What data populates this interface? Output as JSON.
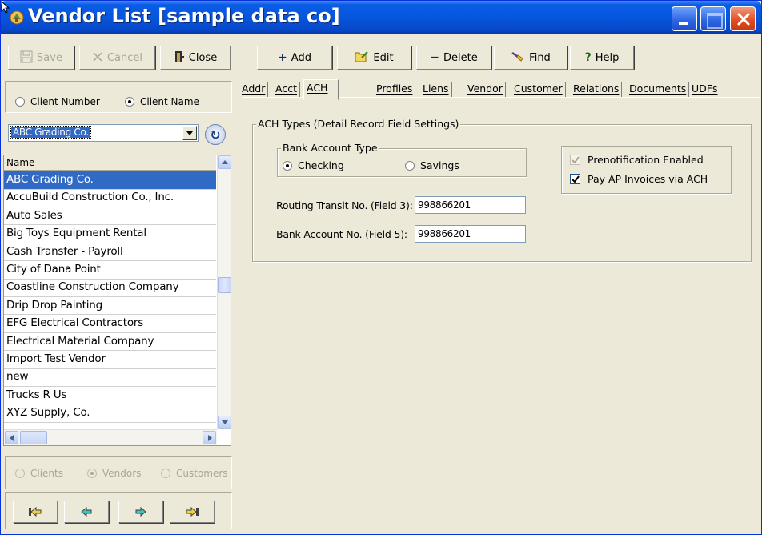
{
  "window": {
    "title": "Vendor List [sample data co]"
  },
  "toolbar": {
    "save": "Save",
    "cancel": "Cancel",
    "close": "Close",
    "add": "Add",
    "edit": "Edit",
    "delete": "Delete",
    "find": "Find",
    "help": "Help"
  },
  "sort": {
    "client_number": "Client Number",
    "client_name": "Client Name",
    "selected": "client_name"
  },
  "combo": {
    "value": "ABC Grading Co."
  },
  "list": {
    "header": "Name",
    "rows": [
      "ABC Grading Co.",
      "AccuBuild Construction Co., Inc.",
      "Auto Sales",
      "Big Toys Equipment Rental",
      "Cash Transfer - Payroll",
      "City of Dana Point",
      "Coastline Construction Company",
      "Drip Drop Painting",
      "EFG Electrical Contractors",
      "Electrical Material Company",
      "Import Test Vendor",
      "new",
      "Trucks R Us",
      "XYZ Supply, Co."
    ],
    "selected_index": 0
  },
  "entity_type": {
    "clients": "Clients",
    "vendors": "Vendors",
    "customers": "Customers",
    "selected": "vendors"
  },
  "tabs": [
    "Addr",
    "Acct",
    "ACH",
    "Profiles",
    "Liens",
    "Vendor",
    "Customer",
    "Relations",
    "Documents",
    "UDFs"
  ],
  "active_tab": "ACH",
  "ach": {
    "group_title": "ACH Types (Detail Record Field Settings)",
    "bank_account_type": {
      "title": "Bank Account Type",
      "checking": "Checking",
      "savings": "Savings",
      "selected": "checking"
    },
    "prenotification": {
      "label": "Prenotification Enabled",
      "checked": true,
      "enabled": false
    },
    "pay_ap": {
      "label": "Pay AP Invoices via ACH",
      "checked": true,
      "enabled": true
    },
    "routing": {
      "label": "Routing Transit No. (Field 3):",
      "value": "998866201"
    },
    "account": {
      "label": "Bank Account No. (Field 5):",
      "value": "998866201"
    }
  },
  "colors": {
    "titlebar": "#0655dd",
    "selection": "#316ac5",
    "window_bg": "#ece9d8"
  }
}
